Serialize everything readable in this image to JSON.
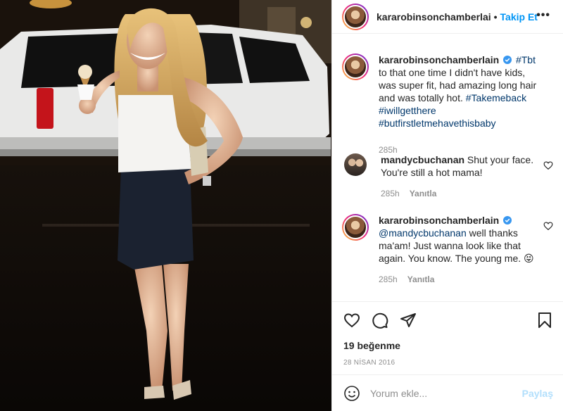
{
  "header": {
    "username": "kararobinsonchamberlai",
    "separator": "•",
    "follow_label": "Takip Et",
    "more_icon": "more-icon"
  },
  "caption": {
    "username": "kararobinsonchamberlain",
    "verified": true,
    "text_parts": [
      "#Tbt",
      " to that one time I didn't have kids, was super fit, had amazing long hair and was totally hot. ",
      "#Takemeback",
      " ",
      "#iwillgetthere",
      " ",
      "#butfirstletmehavethisbaby"
    ],
    "time": "285h"
  },
  "comments": [
    {
      "username": "mandycbuchanan",
      "text": "Shut your face. You're still a hot mama!",
      "time": "285h",
      "reply_label": "Yanıtla"
    },
    {
      "username": "kararobinsonchamberlain",
      "verified": true,
      "mention": "@mandycbuchanan",
      "text": " well thanks ma'am! Just wanna look like that again. You know. The young me. 😝",
      "time": "285h",
      "reply_label": "Yanıtla"
    }
  ],
  "actions": {
    "like_icon": "heart-icon",
    "comment_icon": "comment-icon",
    "share_icon": "paper-plane-icon",
    "save_icon": "bookmark-icon"
  },
  "likes": "19 beğenme",
  "date": "28 NİSAN 2016",
  "add_comment": {
    "placeholder": "Yorum ekle...",
    "share_label": "Paylaş",
    "emoji_icon": "smiley-icon"
  },
  "colors": {
    "link": "#00376b",
    "accent": "#0095f6",
    "verified": "#3897f0",
    "muted": "#8e8e8e"
  }
}
